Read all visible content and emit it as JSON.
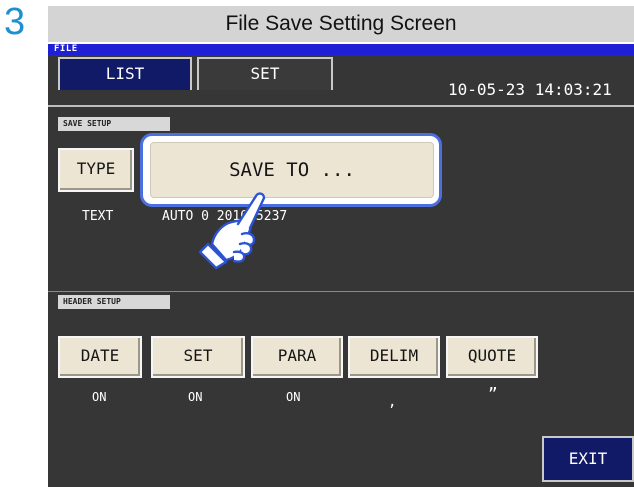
{
  "step_number": "3",
  "caption": "File Save Setting Screen",
  "window_title": "FILE",
  "tabs": {
    "list": "LIST",
    "set": "SET"
  },
  "datetime": "10-05-23 14:03:21",
  "save_setup": {
    "section_label": "SAVE SETUP",
    "type_button": "TYPE",
    "save_to_button": "SAVE TO ...",
    "type_value": "TEXT",
    "save_to_value": "AUTO  0  201005237"
  },
  "header_setup": {
    "section_label": "HEADER SETUP",
    "buttons": [
      {
        "label": "DATE",
        "value": "ON"
      },
      {
        "label": "SET",
        "value": "ON"
      },
      {
        "label": "PARA",
        "value": "ON"
      },
      {
        "label": "DELIM",
        "value": ","
      },
      {
        "label": "QUOTE",
        "value": "”"
      }
    ]
  },
  "exit_button": "EXIT",
  "icons": {
    "hand": "hand-pointer-icon"
  },
  "colors": {
    "accent_blue": "#1f1fd6",
    "step_blue": "#1e8fd0",
    "tab_active": "#101a66",
    "highlight_ring": "#4c6fe0"
  }
}
